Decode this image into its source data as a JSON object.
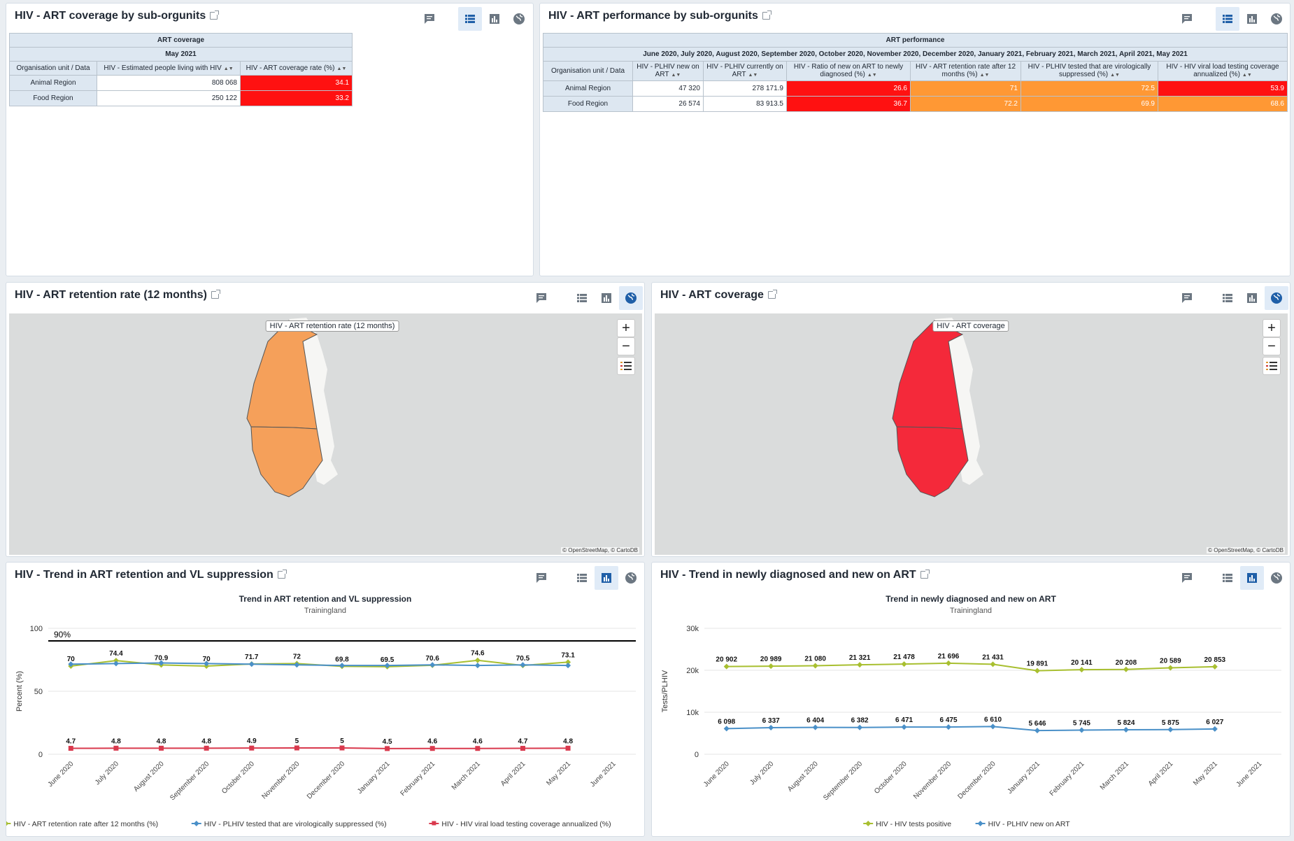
{
  "cards": {
    "coverage_table": {
      "title": "HIV - ART coverage by sub-orgunits",
      "header1": "ART coverage",
      "header2": "May 2021",
      "col_org": "Organisation unit / Data",
      "columns": [
        "HIV - Estimated people living with HIV",
        "HIV - ART coverage rate (%)"
      ],
      "rows": [
        {
          "org": "Animal Region",
          "v1": "808 068",
          "v2": "34.1"
        },
        {
          "org": "Food Region",
          "v1": "250 122",
          "v2": "33.2"
        }
      ]
    },
    "performance_table": {
      "title": "HIV - ART performance by sub-orgunits",
      "header1": "ART performance",
      "header2": "June 2020, July 2020, August 2020, September 2020, October 2020, November 2020, December 2020, January 2021, February 2021, March 2021, April 2021, May 2021",
      "col_org": "Organisation unit / Data",
      "columns": [
        "HIV - PLHIV new on ART",
        "HIV - PLHIV currently on ART",
        "HIV - Ratio of new on ART to newly diagnosed (%)",
        "HIV - ART retention rate after 12 months (%)",
        "HIV - PLHIV tested that are virologically suppressed (%)",
        "HIV - HIV viral load testing coverage annualized (%)"
      ],
      "rows": [
        {
          "org": "Animal Region",
          "vals": [
            "47 320",
            "278 171.9",
            "26.6",
            "71",
            "72.5",
            "53.9"
          ]
        },
        {
          "org": "Food Region",
          "vals": [
            "26 574",
            "83 913.5",
            "36.7",
            "72.2",
            "69.9",
            "68.6"
          ]
        }
      ]
    },
    "retention_map": {
      "title": "HIV - ART retention rate (12 months)",
      "layer_label": "HIV - ART retention rate (12 months)",
      "fill": "#f5a05a",
      "zoom_in": "+",
      "zoom_out": "−",
      "attribution": "© OpenStreetMap, © CartoDB"
    },
    "coverage_map": {
      "title": "HIV - ART coverage",
      "layer_label": "HIV - ART coverage",
      "fill": "#f4293a",
      "zoom_in": "+",
      "zoom_out": "−",
      "attribution": "© OpenStreetMap, © CartoDB"
    },
    "trend_retention": {
      "title": "HIV - Trend in ART retention and VL suppression",
      "chart_title": "Trend in ART retention and VL suppression",
      "chart_subtitle": "Trainingland"
    },
    "trend_diagnosed": {
      "title": "HIV - Trend in newly diagnosed and new on ART",
      "chart_title": "Trend in newly diagnosed and new on ART",
      "chart_subtitle": "Trainingland"
    }
  },
  "colors": {
    "red": "#ff1111",
    "orange": "#ff9834",
    "green_series": "#a8bf30",
    "blue_series": "#4a90c8",
    "red_series": "#d9394d",
    "active_icon": "#1f5fa8"
  },
  "chart_data": [
    {
      "type": "line",
      "title": "Trend in ART retention and VL suppression",
      "subtitle": "Trainingland",
      "ylabel": "Percent (%)",
      "ylim": [
        0,
        100
      ],
      "yticks": [
        0,
        50,
        100
      ],
      "target_line": {
        "value": 90,
        "label": "90%"
      },
      "categories": [
        "June 2020",
        "July 2020",
        "August 2020",
        "September 2020",
        "October 2020",
        "November 2020",
        "December 2020",
        "January 2021",
        "February 2021",
        "March 2021",
        "April 2021",
        "May 2021",
        "June 2021"
      ],
      "series": [
        {
          "name": "HIV - ART retention rate after 12 months (%)",
          "color": "#a8bf30",
          "values": [
            70,
            74.4,
            70.9,
            70,
            71.7,
            72,
            69.8,
            69.5,
            70.6,
            74.6,
            70.5,
            73.1
          ],
          "labels": [
            "70",
            "74.4",
            "70.9",
            "70",
            "71.7",
            "72",
            "69.8",
            "69.5",
            "70.6",
            "74.6",
            "70.5",
            "73.1"
          ]
        },
        {
          "name": "HIV - PLHIV tested that are virologically suppressed (%)",
          "color": "#4a90c8",
          "values": [
            71.5,
            72,
            72.5,
            72,
            71.5,
            71,
            70.5,
            70.5,
            71,
            70.5,
            71,
            70.5
          ],
          "labels": null
        },
        {
          "name": "HIV - HIV viral load testing coverage annualized (%)",
          "color": "#d9394d",
          "values": [
            4.7,
            4.8,
            4.8,
            4.8,
            4.9,
            5,
            5,
            4.5,
            4.6,
            4.6,
            4.7,
            4.8
          ],
          "labels": [
            "4.7",
            "4.8",
            "4.8",
            "4.8",
            "4.9",
            "5",
            "5",
            "4.5",
            "4.6",
            "4.6",
            "4.7",
            "4.8"
          ]
        }
      ]
    },
    {
      "type": "line",
      "title": "Trend in newly diagnosed and new on ART",
      "subtitle": "Trainingland",
      "ylabel": "Tests/PLHIV",
      "ylim": [
        0,
        30000
      ],
      "yticks": [
        0,
        10000,
        20000,
        30000
      ],
      "ytick_labels": [
        "0",
        "10k",
        "20k",
        "30k"
      ],
      "categories": [
        "June 2020",
        "July 2020",
        "August 2020",
        "September 2020",
        "October 2020",
        "November 2020",
        "December 2020",
        "January 2021",
        "February 2021",
        "March 2021",
        "April 2021",
        "May 2021",
        "June 2021"
      ],
      "series": [
        {
          "name": "HIV - HIV tests positive",
          "color": "#a8bf30",
          "values": [
            20902,
            20989,
            21080,
            21321,
            21478,
            21696,
            21431,
            19891,
            20141,
            20208,
            20589,
            20853
          ],
          "labels": [
            "20 902",
            "20 989",
            "21 080",
            "21 321",
            "21 478",
            "21 696",
            "21 431",
            "19 891",
            "20 141",
            "20 208",
            "20 589",
            "20 853"
          ]
        },
        {
          "name": "HIV - PLHIV new on ART",
          "color": "#4a90c8",
          "values": [
            6098,
            6337,
            6404,
            6382,
            6471,
            6475,
            6610,
            5646,
            5745,
            5824,
            5875,
            6027
          ],
          "labels": [
            "6 098",
            "6 337",
            "6 404",
            "6 382",
            "6 471",
            "6 475",
            "6 610",
            "5 646",
            "5 745",
            "5 824",
            "5 875",
            "6 027"
          ]
        }
      ]
    }
  ]
}
